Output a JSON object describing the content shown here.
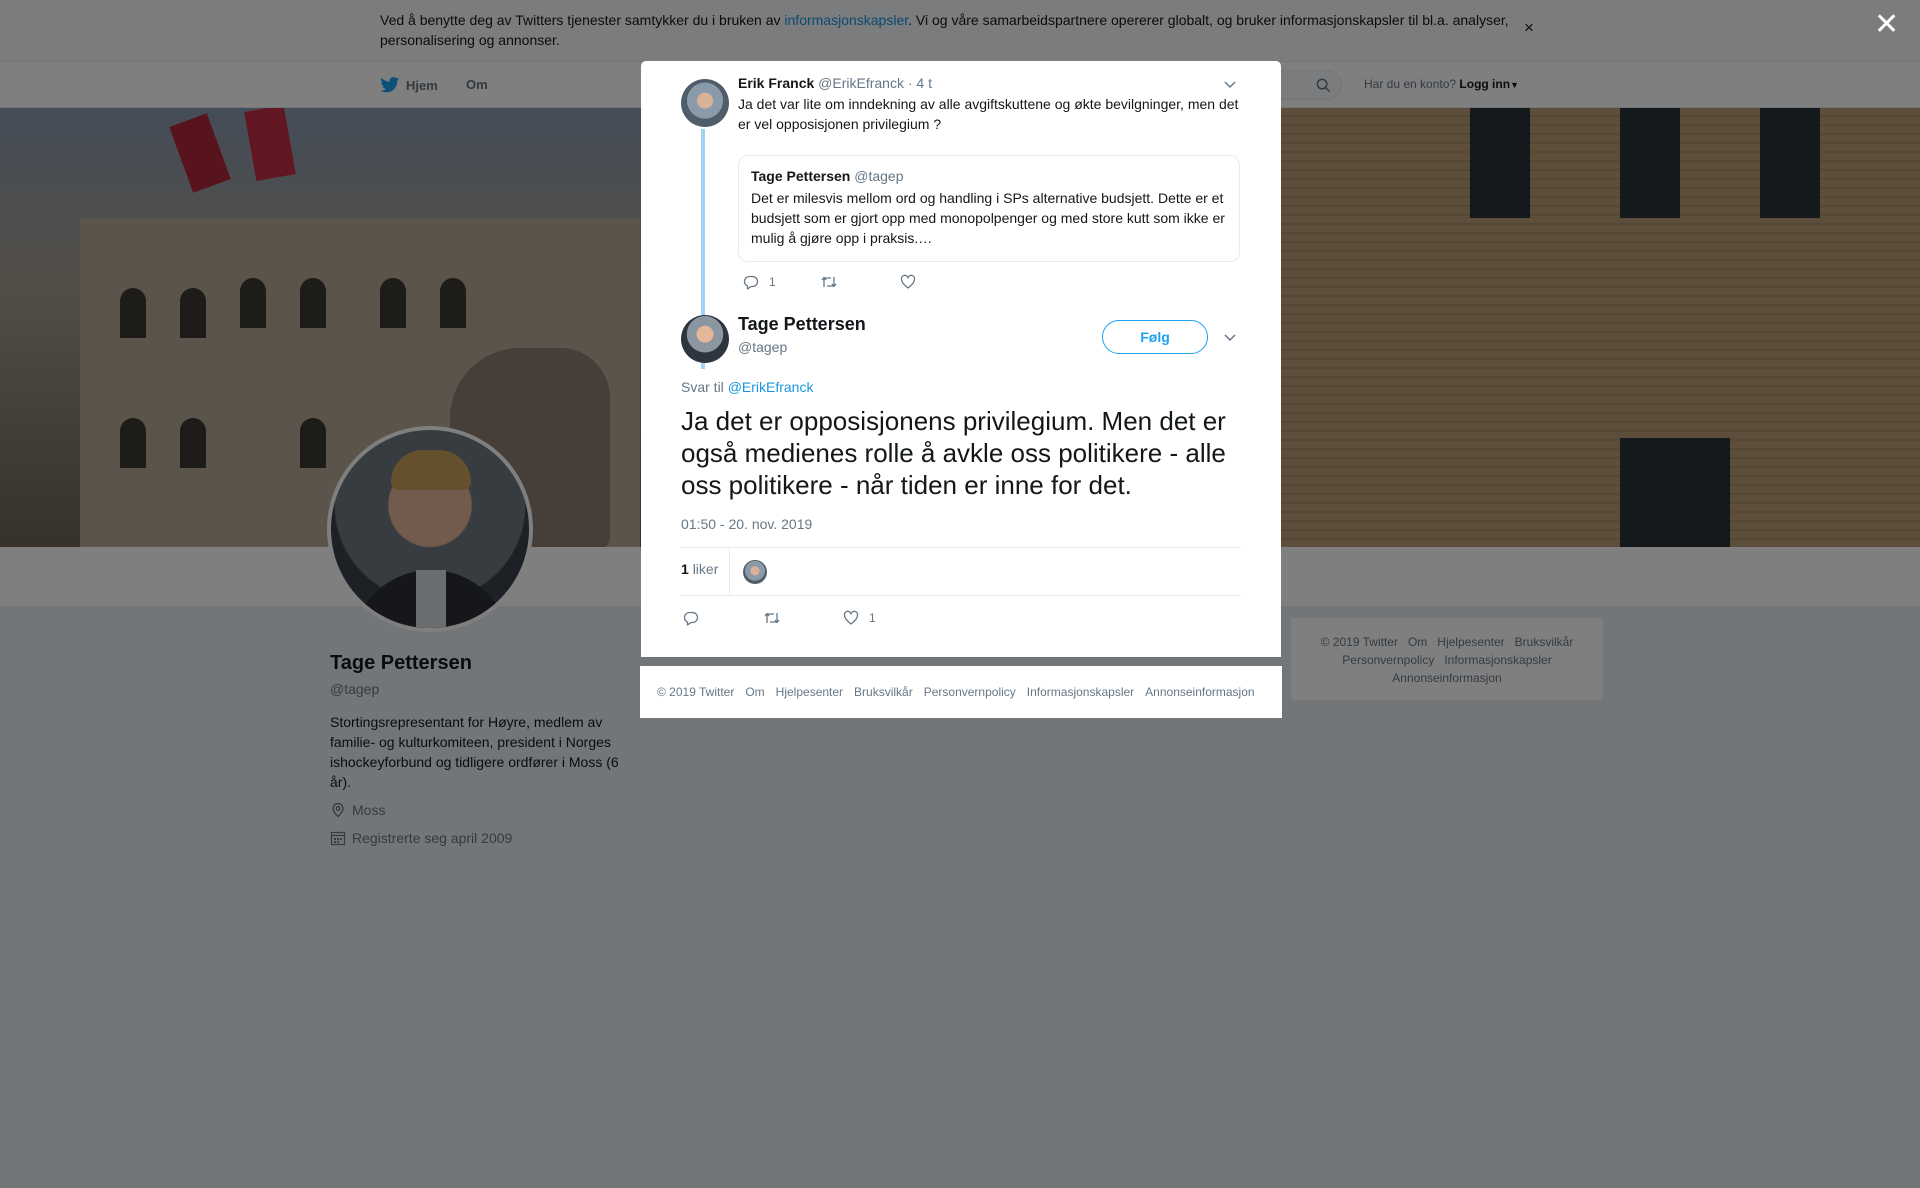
{
  "cookie_bar": {
    "text_before": "Ved å benytte deg av Twitters tjenester samtykker du i bruken av ",
    "link": "informasjonskapsler",
    "text_after": ". Vi og våre samarbeidspartnere opererer globalt, og bruker informasjonskapsler til bl.a. analyser, personalisering og annonser.",
    "close": "×"
  },
  "nav": {
    "home": "Hjem",
    "about": "Om",
    "login_prompt": "Har du en konto?",
    "login": "Logg inn"
  },
  "profile": {
    "name": "Tage Pettersen",
    "handle": "@tagep",
    "bio": "Stortingsrepresentant for Høyre, medlem av familie- og kulturkomiteen, president i Norges ishockeyforbund og tidligere ordfører i Moss (6 år).",
    "location": "Moss",
    "joined": "Registrerte seg april 2009"
  },
  "right_footer": {
    "items": [
      "© 2019 Twitter",
      "Om",
      "Hjelpesenter",
      "Bruksvilkår",
      "Personvernpolicy",
      "Informasjonskapsler",
      "Annonseinformasjon"
    ]
  },
  "overlay": {
    "close": "✕"
  },
  "parent_tweet": {
    "name": "Erik Franck",
    "handle": "@ErikEfranck",
    "time": "· 4 t",
    "text": "Ja det var lite om inndekning av alle avgiftskuttene og økte bevilgninger, men det er vel opposisjonen privilegium ?",
    "quote": {
      "name": "Tage Pettersen",
      "handle": "@tagep",
      "text": "Det er milesvis mellom ord og handling i SPs alternative budsjett. Dette er et budsjett som er gjort opp med monopolpenger og med store kutt som ikke er mulig å gjøre opp i praksis.…"
    },
    "reply_count": "1"
  },
  "main_tweet": {
    "name": "Tage Pettersen",
    "handle": "@tagep",
    "follow": "Følg",
    "reply_prefix": "Svar til",
    "reply_to": "@ErikEfranck",
    "text": "Ja det er opposisjonens privilegium. Men det er også medienes rolle å avkle oss politikere - alle oss politikere - når tiden er inne for det.",
    "timestamp": "01:50 - 20. nov. 2019",
    "likes_num": "1",
    "likes_label": "liker",
    "like_count": "1"
  },
  "modal_footer": {
    "items": [
      "© 2019 Twitter",
      "Om",
      "Hjelpesenter",
      "Bruksvilkår",
      "Personvernpolicy",
      "Informasjonskapsler",
      "Annonseinformasjon"
    ]
  },
  "colors": {
    "accent": "#1da1f2",
    "link": "#1b95e0",
    "muted": "#657786",
    "thread": "#a3d3f4"
  }
}
